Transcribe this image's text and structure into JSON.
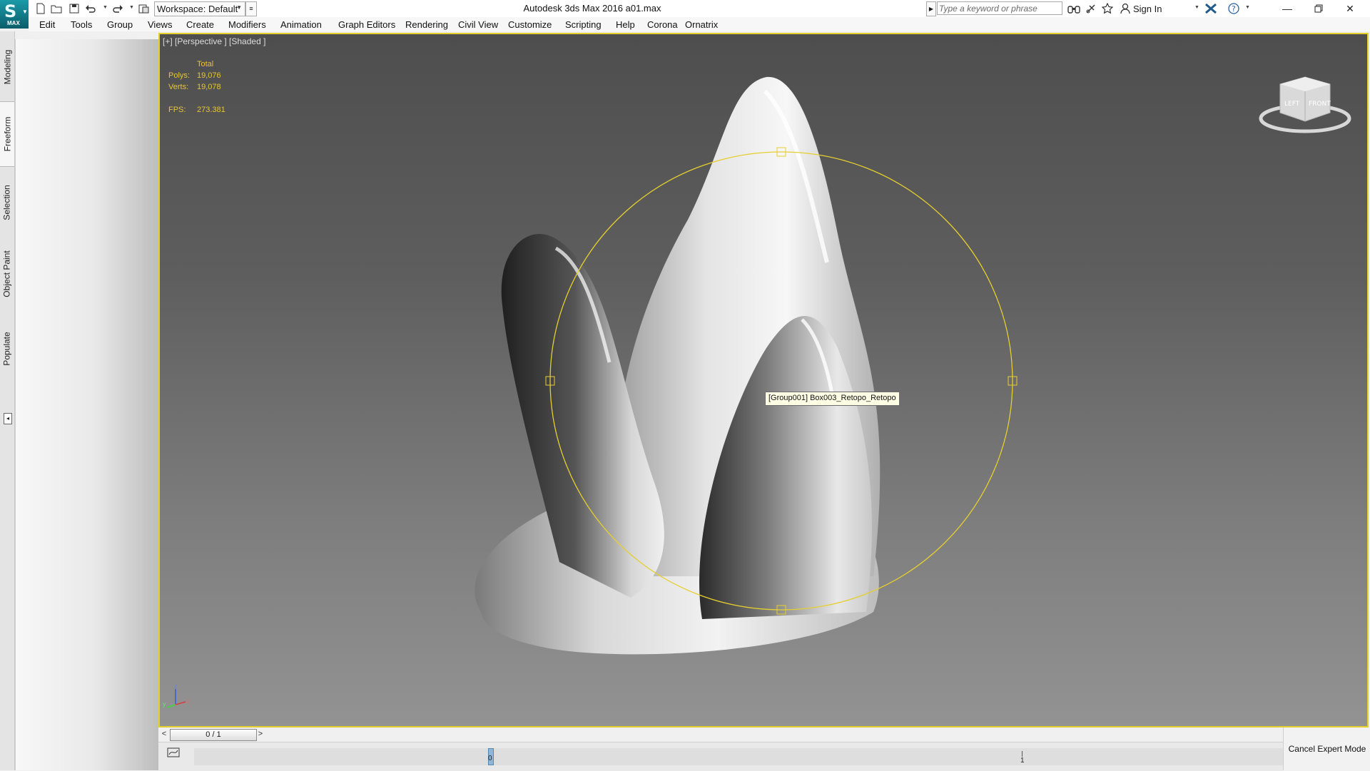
{
  "app": {
    "logo_text": "MAX",
    "window_title": "Autodesk 3ds Max 2016     a01.max"
  },
  "quick_access": {
    "workspace_label": "Workspace: Default"
  },
  "infocenter": {
    "search_placeholder": "Type a keyword or phrase",
    "sign_in_label": "Sign In"
  },
  "menu": {
    "items": [
      {
        "label": "Edit"
      },
      {
        "label": "Tools"
      },
      {
        "label": "Group"
      },
      {
        "label": "Views"
      },
      {
        "label": "Create"
      },
      {
        "label": "Modifiers"
      },
      {
        "label": "Animation"
      },
      {
        "label": "Graph Editors"
      },
      {
        "label": "Rendering"
      },
      {
        "label": "Civil View"
      },
      {
        "label": "Customize"
      },
      {
        "label": "Scripting"
      },
      {
        "label": "Help"
      },
      {
        "label": "Corona"
      },
      {
        "label": "Ornatrix"
      }
    ]
  },
  "ribbon": {
    "tabs": [
      {
        "label": "Modeling",
        "active": false
      },
      {
        "label": "Freeform",
        "active": true
      },
      {
        "label": "Selection",
        "active": false
      },
      {
        "label": "Object Paint",
        "active": false
      },
      {
        "label": "Populate",
        "active": false
      }
    ]
  },
  "viewport": {
    "label": "[+] [Perspective ] [Shaded ]",
    "stats": {
      "header": "Total",
      "polys_label": "Polys:",
      "polys_value": "19,076",
      "verts_label": "Verts:",
      "verts_value": "19,078",
      "fps_label": "FPS:",
      "fps_value": "273.381"
    },
    "tooltip": "[Group001] Box003_Retopo_Retopo",
    "viewcube_faces": {
      "left": "LEFT",
      "front": "FRONT"
    },
    "axes": {
      "x": "x",
      "y": "y",
      "z": "z"
    },
    "colors": {
      "selection_gizmo": "#e5cf2f",
      "stats_text": "#e7c43b",
      "viewport_border": "#e5cf2f"
    }
  },
  "timeline": {
    "frame_display": "0 / 1",
    "prev_label": "<",
    "next_label": ">",
    "track_labels": {
      "start": "0",
      "end": "1"
    }
  },
  "status": {
    "cancel_expert_label": "Cancel Expert Mode"
  }
}
